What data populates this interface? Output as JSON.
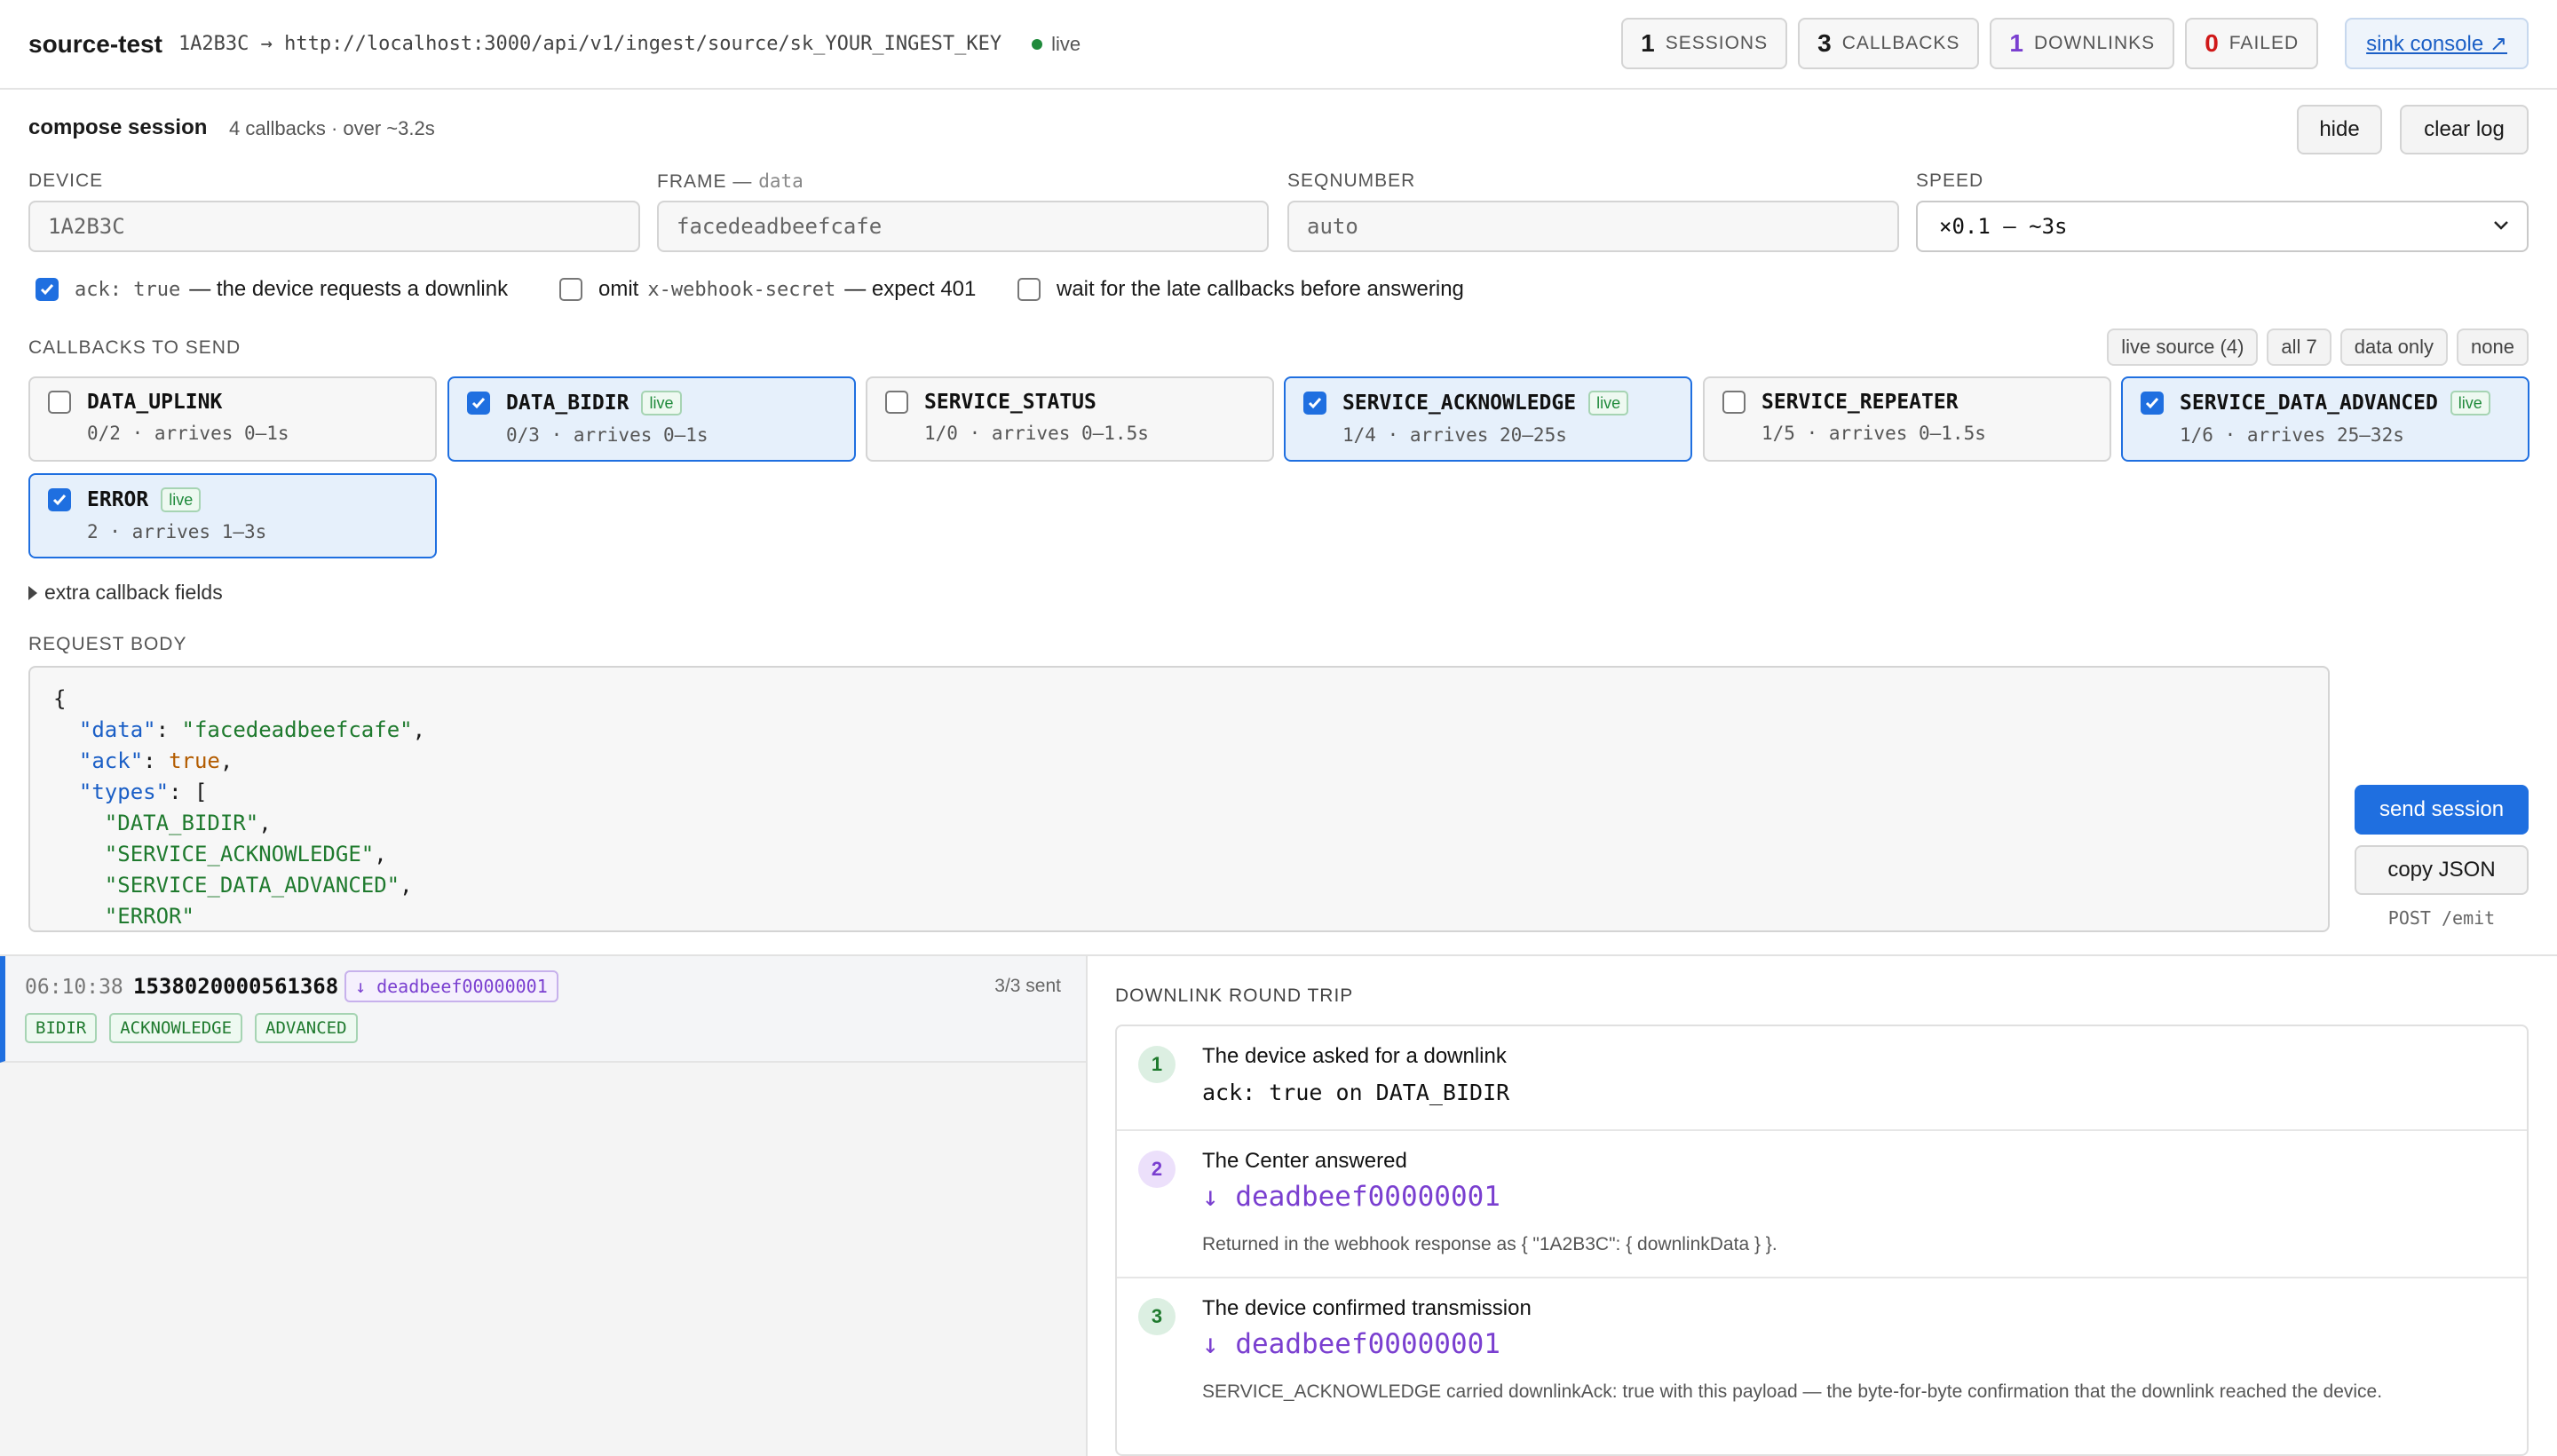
{
  "header": {
    "title": "source-test",
    "endpoint": "1A2B3C → http://localhost:3000/api/v1/ingest/source/sk_YOUR_INGEST_KEY",
    "status": "live",
    "stats": [
      {
        "num": "1",
        "label": "SESSIONS"
      },
      {
        "num": "3",
        "label": "CALLBACKS"
      },
      {
        "num": "1",
        "label": "DOWNLINKS"
      },
      {
        "num": "0",
        "label": "FAILED"
      }
    ],
    "sink_label": "sink console ↗"
  },
  "compose": {
    "title": "compose session",
    "subtitle": "4 callbacks · over ~3.2s",
    "hide_label": "hide",
    "clear_label": "clear log",
    "fields": {
      "device_label": "DEVICE",
      "device_value": "1A2B3C",
      "frame_label": "FRAME —",
      "frame_sub": "data",
      "frame_value": "facedeadbeefcafe",
      "seq_label": "SEQNUMBER",
      "seq_placeholder": "auto",
      "speed_label": "SPEED",
      "speed_value": "×0.1 — ~3s"
    },
    "options": {
      "ack_code": "ack: true",
      "ack_text": "— the device requests a downlink",
      "omit_prefix": "omit",
      "omit_code": "x-webhook-secret",
      "omit_text": "— expect 401",
      "wait_text": "wait for the late callbacks before answering"
    },
    "callbacks_label": "CALLBACKS TO SEND",
    "filters": [
      "live source (4)",
      "all 7",
      "data only",
      "none"
    ],
    "callbacks": [
      {
        "name": "DATA_UPLINK",
        "meta": "0/2 · arrives 0–1s",
        "checked": false,
        "live": false
      },
      {
        "name": "DATA_BIDIR",
        "meta": "0/3 · arrives 0–1s",
        "checked": true,
        "live": true
      },
      {
        "name": "SERVICE_STATUS",
        "meta": "1/0 · arrives 0–1.5s",
        "checked": false,
        "live": false
      },
      {
        "name": "SERVICE_ACKNOWLEDGE",
        "meta": "1/4 · arrives 20–25s",
        "checked": true,
        "live": true
      },
      {
        "name": "SERVICE_REPEATER",
        "meta": "1/5 · arrives 0–1.5s",
        "checked": false,
        "live": false
      },
      {
        "name": "SERVICE_DATA_ADVANCED",
        "meta": "1/6 · arrives 25–32s",
        "checked": true,
        "live": true
      },
      {
        "name": "ERROR",
        "meta": "2 · arrives 1–3s",
        "checked": true,
        "live": true
      }
    ],
    "live_badge": "live",
    "extra_label": "extra callback fields",
    "request_body_label": "REQUEST BODY",
    "send_label": "send session",
    "copy_label": "copy JSON",
    "post_label": "POST /emit"
  },
  "request_body": {
    "data": "facedeadbeefcafe",
    "ack": "true",
    "types": [
      "DATA_BIDIR",
      "SERVICE_ACKNOWLEDGE",
      "SERVICE_DATA_ADVANCED",
      "ERROR"
    ]
  },
  "session": {
    "time": "06:10:38",
    "id": "1538020000561368",
    "downlink": "↓ deadbeef00000001",
    "sent": "3/3 sent",
    "tags": [
      "BIDIR",
      "ACKNOWLEDGE",
      "ADVANCED"
    ]
  },
  "roundtrip": {
    "title": "DOWNLINK ROUND TRIP",
    "steps": [
      {
        "num": "1",
        "title": "The device asked for a downlink",
        "code": "ack: true on DATA_BIDIR"
      },
      {
        "num": "2",
        "title": "The Center answered",
        "downlink": "↓ deadbeef00000001",
        "note": "Returned in the webhook response as { \"1A2B3C\": { downlinkData } }."
      },
      {
        "num": "3",
        "title": "The device confirmed transmission",
        "downlink": "↓ deadbeef00000001",
        "note": "SERVICE_ACKNOWLEDGE carried downlinkAck: true with this payload — the byte-for-byte confirmation that the downlink reached the device."
      }
    ]
  },
  "colors": {
    "accent": "#1f6fe0",
    "live": "#1f8a3b",
    "downlink": "#7a3fd0",
    "failed": "#d01919"
  }
}
